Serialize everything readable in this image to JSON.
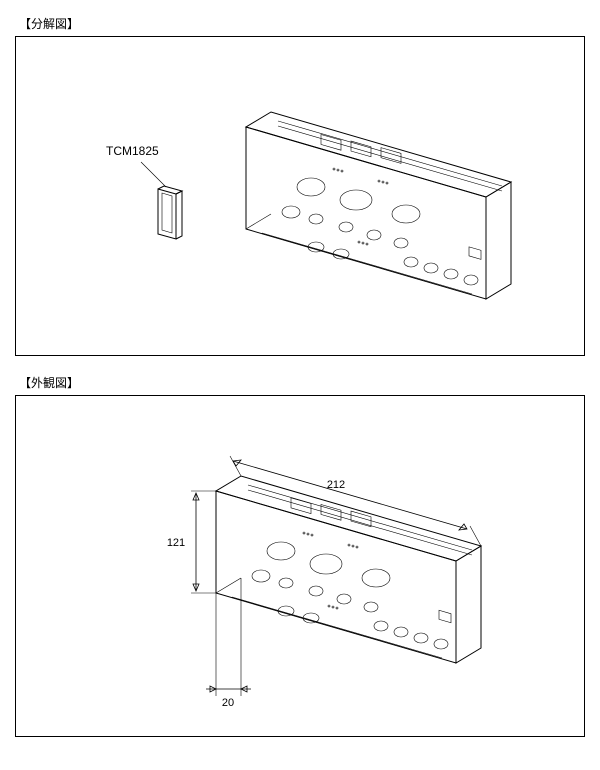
{
  "figures": {
    "exploded": {
      "title": "【分解図】",
      "callout": "TCM1825"
    },
    "external": {
      "title": "【外観図】",
      "dims": {
        "width": "212",
        "height": "121",
        "depth": "20"
      }
    }
  }
}
